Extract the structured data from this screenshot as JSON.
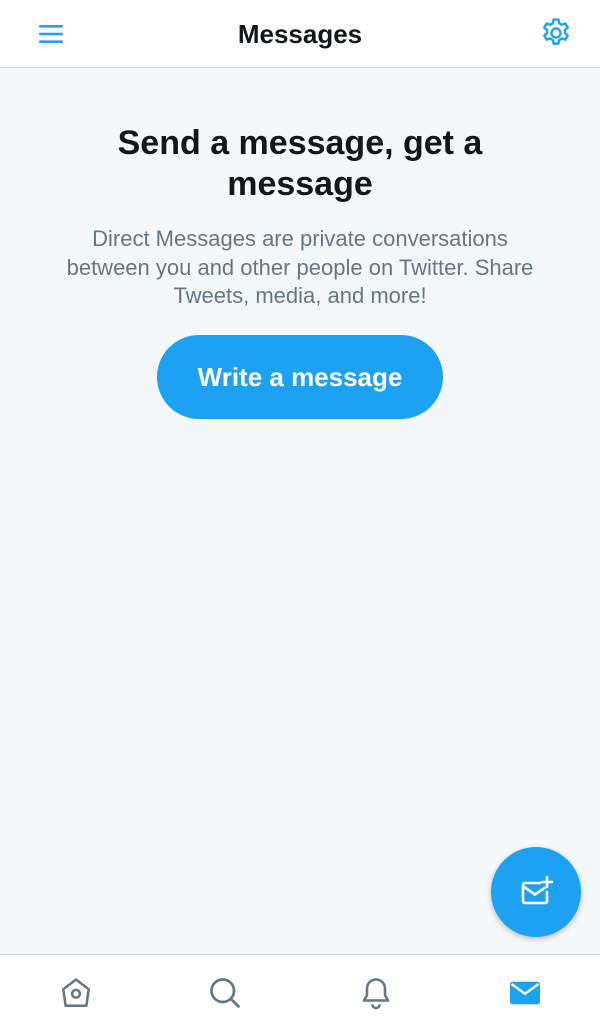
{
  "header": {
    "title": "Messages",
    "menu_icon": "hamburger-menu-icon",
    "settings_icon": "gear-icon"
  },
  "empty_state": {
    "headline": "Send a message, get a message",
    "body": "Direct Messages are private conversations between you and other people on Twitter. Share Tweets, media, and more!",
    "cta_label": "Write a message"
  },
  "fab": {
    "icon": "new-message-icon"
  },
  "tabbar": {
    "tabs": [
      {
        "id": "home",
        "icon": "home-icon",
        "active": false
      },
      {
        "id": "search",
        "icon": "search-icon",
        "active": false
      },
      {
        "id": "notifications",
        "icon": "bell-icon",
        "active": false
      },
      {
        "id": "messages",
        "icon": "envelope-icon",
        "active": true
      }
    ]
  },
  "colors": {
    "accent": "#1da1f2",
    "text_primary": "#14171a",
    "text_secondary": "#657786",
    "background": "#f5f8fa",
    "icon_inactive": "#657786"
  }
}
